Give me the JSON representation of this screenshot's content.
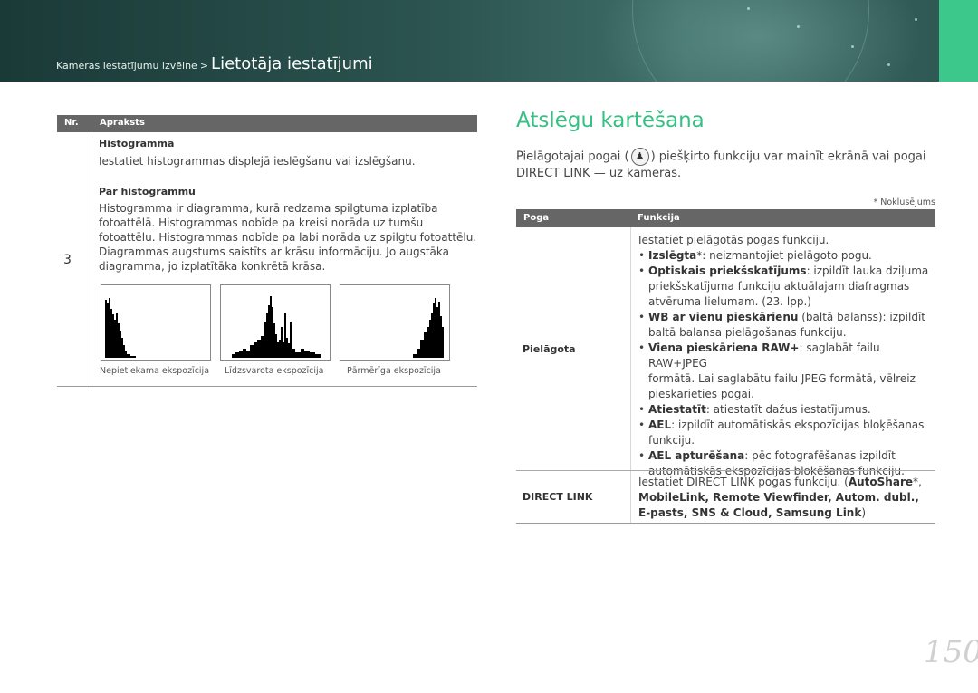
{
  "header": {
    "breadcrumb_parent": "Kameras iestatījumu izvēlne",
    "breadcrumb_separator": ">",
    "breadcrumb_current": "Lietotāja iestatījumi"
  },
  "left_table": {
    "col_nr": "Nr.",
    "col_desc": "Apraksts",
    "row_number": "3",
    "histogram_heading": "Histogramma",
    "histogram_text": "Iestatiet histogrammas displejā ieslēgšanu vai izslēgšanu.",
    "about_heading": "Par histogrammu",
    "about_lines": [
      "Histogramma ir diagramma, kurā redzama spilgtuma izplatība",
      "fotoattēlā. Histogrammas nobīde pa kreisi norāda uz tumšu",
      "fotoattēlu. Histogrammas nobīde pa labi norāda uz spilgtu fotoattēlu.",
      "Diagrammas augstums saistīts ar krāsu informāciju. Jo augstāka",
      "diagramma, jo izplatītāka konkrētā krāsa."
    ],
    "histograms": [
      {
        "caption": "Nepietiekama ekspozīcija",
        "shape": "left"
      },
      {
        "caption": "Līdzsvarota ekspozīcija",
        "shape": "center"
      },
      {
        "caption": "Pārmērīga ekspozīcija",
        "shape": "right"
      }
    ]
  },
  "right": {
    "title": "Atslēgu kartēšana",
    "intro_part1": "Pielāgotajai pogai (",
    "intro_part2": ") piešķirto funkciju var mainīt ekrānā vai pogai",
    "intro_line2": "DIRECT LINK — uz kameras.",
    "footnote": "* Noklusējums",
    "col_button": "Poga",
    "col_function": "Funkcija",
    "custom": {
      "label": "Pielāgota",
      "intro": "Iestatiet pielāgotās pogas funkciju.",
      "bullets": [
        {
          "bold": "Izslēgta",
          "rest": "*: neizmantojiet pielāgoto pogu.",
          "lines": []
        },
        {
          "bold": "Optiskais priekšskatījums",
          "rest": ": izpildīt lauka dziļuma",
          "lines": [
            "priekšskatījuma funkciju aktuālajam diafragmas",
            "atvēruma lielumam. (23. lpp.)"
          ]
        },
        {
          "bold": "WB ar vienu pieskārienu",
          "rest": " (baltā balanss): izpildīt",
          "lines": [
            "baltā balansa pielāgošanas funkciju."
          ]
        },
        {
          "bold": "Viena pieskāriena RAW+",
          "rest": ": saglabāt failu RAW+JPEG",
          "lines": [
            "formātā. Lai saglabātu failu JPEG formātā, vēlreiz",
            "pieskarieties pogai."
          ]
        },
        {
          "bold": "Atiestatīt",
          "rest": ": atiestatīt dažus iestatījumus.",
          "lines": []
        },
        {
          "bold": "AEL",
          "rest": ": izpildīt automātiskās ekspozīcijas bloķēšanas",
          "lines": [
            "funkciju."
          ]
        },
        {
          "bold": "AEL apturēšana",
          "rest": ": pēc fotografēšanas izpildīt",
          "lines": [
            "automātiskās ekspozīcijas bloķēšanas funkciju."
          ]
        }
      ]
    },
    "direct_link": {
      "label": "DIRECT LINK",
      "line1": "Iestatiet DIRECT LINK pogas funkciju. (",
      "line1_bold": "AutoShare",
      "line1_end": "*,",
      "line2": "MobileLink, Remote Viewfinder, Autom. dubl.,",
      "line3": "E-pasts, SNS & Cloud, Samsung Link",
      "line3_end": ")"
    },
    "page_number": "150"
  }
}
